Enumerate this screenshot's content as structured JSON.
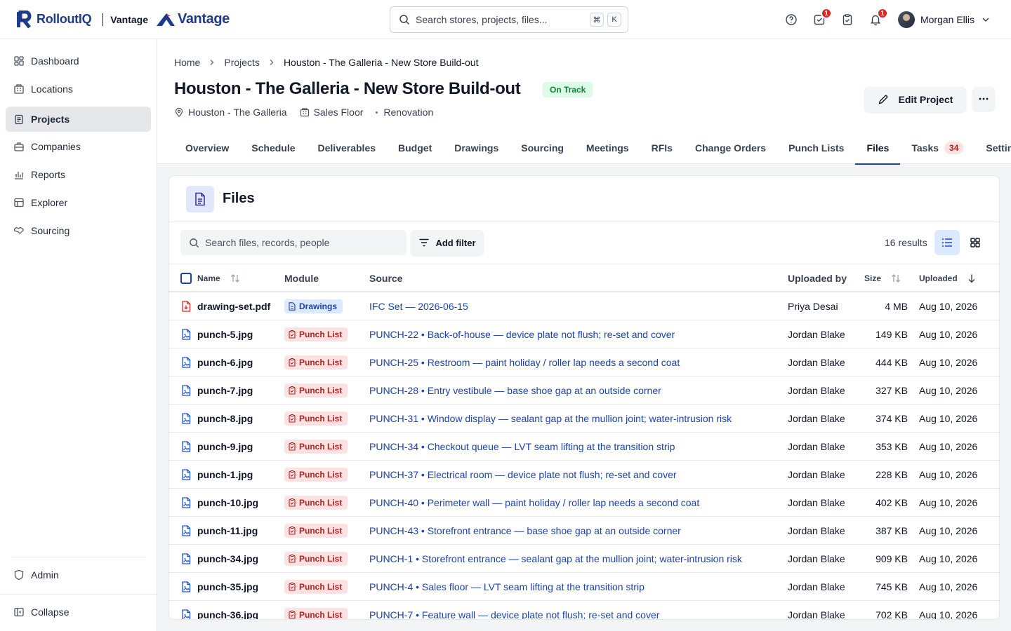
{
  "brand": {
    "name": "RolloutIQ",
    "sub": "Vantage",
    "partner": "Vantage"
  },
  "search": {
    "placeholder": "Search stores, projects, files...",
    "kbd1": "⌘",
    "kbd2": "K"
  },
  "top": {
    "tasks_badge": "1",
    "notif_badge": "1",
    "user_name": "Morgan Ellis"
  },
  "sidebar": {
    "items": [
      {
        "label": "Dashboard",
        "icon": "dashboard-icon"
      },
      {
        "label": "Locations",
        "icon": "building-icon"
      },
      {
        "label": "Projects",
        "icon": "clipboard-icon",
        "active": true
      },
      {
        "label": "Companies",
        "icon": "briefcase-icon"
      },
      {
        "label": "Reports",
        "icon": "bar-chart-icon"
      },
      {
        "label": "Explorer",
        "icon": "table-icon"
      },
      {
        "label": "Sourcing",
        "icon": "handshake-icon"
      }
    ],
    "admin": "Admin",
    "collapse": "Collapse"
  },
  "breadcrumb": [
    "Home",
    "Projects",
    "Houston - The Galleria - New Store Build-out"
  ],
  "project": {
    "title": "Houston - The Galleria - New Store Build-out",
    "status": "On Track",
    "location": "Houston - The Galleria",
    "area": "Sales Floor",
    "type": "Renovation",
    "edit_label": "Edit Project"
  },
  "tabs": [
    {
      "label": "Overview"
    },
    {
      "label": "Schedule"
    },
    {
      "label": "Deliverables"
    },
    {
      "label": "Budget"
    },
    {
      "label": "Drawings"
    },
    {
      "label": "Sourcing"
    },
    {
      "label": "Meetings"
    },
    {
      "label": "RFIs"
    },
    {
      "label": "Change Orders"
    },
    {
      "label": "Punch Lists"
    },
    {
      "label": "Files",
      "active": true
    },
    {
      "label": "Tasks",
      "count": "34"
    },
    {
      "label": "Settings"
    }
  ],
  "files": {
    "title": "Files",
    "search_placeholder": "Search files, records, people",
    "filter_label": "Add filter",
    "results": "16 results",
    "columns": {
      "name": "Name",
      "module": "Module",
      "source": "Source",
      "uploaded_by": "Uploaded by",
      "size": "Size",
      "uploaded": "Uploaded"
    },
    "rows": [
      {
        "name": "drawing-set.pdf",
        "kind": "pdf",
        "module": "Drawings",
        "source": "IFC Set — 2026-06-15",
        "by": "Priya Desai",
        "size": "4 MB",
        "date": "Aug 10, 2026"
      },
      {
        "name": "punch-5.jpg",
        "kind": "img",
        "module": "Punch List",
        "source": "PUNCH-22 • Back-of-house — device plate not flush; re-set and cover",
        "by": "Jordan Blake",
        "size": "149 KB",
        "date": "Aug 10, 2026"
      },
      {
        "name": "punch-6.jpg",
        "kind": "img",
        "module": "Punch List",
        "source": "PUNCH-25 • Restroom — paint holiday / roller lap needs a second coat",
        "by": "Jordan Blake",
        "size": "444 KB",
        "date": "Aug 10, 2026"
      },
      {
        "name": "punch-7.jpg",
        "kind": "img",
        "module": "Punch List",
        "source": "PUNCH-28 • Entry vestibule — base shoe gap at an outside corner",
        "by": "Jordan Blake",
        "size": "327 KB",
        "date": "Aug 10, 2026"
      },
      {
        "name": "punch-8.jpg",
        "kind": "img",
        "module": "Punch List",
        "source": "PUNCH-31 • Window display — sealant gap at the mullion joint; water-intrusion risk",
        "by": "Jordan Blake",
        "size": "374 KB",
        "date": "Aug 10, 2026"
      },
      {
        "name": "punch-9.jpg",
        "kind": "img",
        "module": "Punch List",
        "source": "PUNCH-34 • Checkout queue — LVT seam lifting at the transition strip",
        "by": "Jordan Blake",
        "size": "353 KB",
        "date": "Aug 10, 2026"
      },
      {
        "name": "punch-1.jpg",
        "kind": "img",
        "module": "Punch List",
        "source": "PUNCH-37 • Electrical room — device plate not flush; re-set and cover",
        "by": "Jordan Blake",
        "size": "228 KB",
        "date": "Aug 10, 2026"
      },
      {
        "name": "punch-10.jpg",
        "kind": "img",
        "module": "Punch List",
        "source": "PUNCH-40 • Perimeter wall — paint holiday / roller lap needs a second coat",
        "by": "Jordan Blake",
        "size": "402 KB",
        "date": "Aug 10, 2026"
      },
      {
        "name": "punch-11.jpg",
        "kind": "img",
        "module": "Punch List",
        "source": "PUNCH-43 • Storefront entrance — base shoe gap at an outside corner",
        "by": "Jordan Blake",
        "size": "387 KB",
        "date": "Aug 10, 2026"
      },
      {
        "name": "punch-34.jpg",
        "kind": "img",
        "module": "Punch List",
        "source": "PUNCH-1 • Storefront entrance — sealant gap at the mullion joint; water-intrusion risk",
        "by": "Jordan Blake",
        "size": "909 KB",
        "date": "Aug 10, 2026"
      },
      {
        "name": "punch-35.jpg",
        "kind": "img",
        "module": "Punch List",
        "source": "PUNCH-4 • Sales floor — LVT seam lifting at the transition strip",
        "by": "Jordan Blake",
        "size": "745 KB",
        "date": "Aug 10, 2026"
      },
      {
        "name": "punch-36.jpg",
        "kind": "img",
        "module": "Punch List",
        "source": "PUNCH-7 • Feature wall — device plate not flush; re-set and cover",
        "by": "Jordan Blake",
        "size": "702 KB",
        "date": "Aug 10, 2026"
      }
    ]
  },
  "colors": {
    "brand": "#1e3a8a",
    "accent": "#1e40af",
    "punch": "#b91c1c",
    "ok": "#15803d"
  }
}
